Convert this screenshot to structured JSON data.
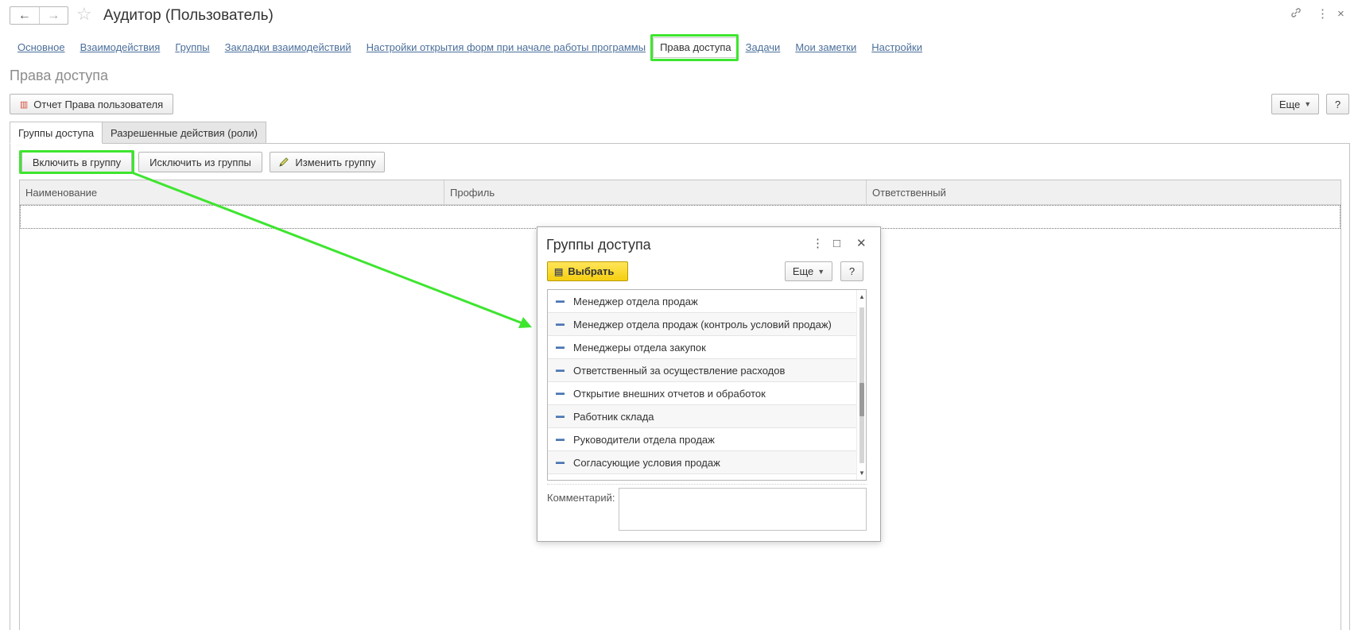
{
  "window": {
    "title": "Аудитор (Пользователь)",
    "back_icon": "←",
    "forward_icon": "→",
    "star_icon": "☆",
    "link_icon": "🔗",
    "more_icon": "⋮",
    "close_icon": "×"
  },
  "sections": [
    {
      "label": "Основное"
    },
    {
      "label": "Взаимодействия"
    },
    {
      "label": "Группы"
    },
    {
      "label": "Закладки взаимодействий"
    },
    {
      "label": "Настройки открытия форм при начале работы программы"
    },
    {
      "label": "Права доступа"
    },
    {
      "label": "Задачи"
    },
    {
      "label": "Мои заметки"
    },
    {
      "label": "Настройки"
    }
  ],
  "form": {
    "title": "Права доступа",
    "report_button": "Отчет Права пользователя",
    "more_button": "Еще",
    "help_button": "?"
  },
  "tabs": [
    {
      "label": "Группы доступа"
    },
    {
      "label": "Разрешенные действия (роли)"
    }
  ],
  "toolbar": {
    "include": "Включить в группу",
    "exclude": "Исключить из группы",
    "change": "Изменить группу"
  },
  "table": {
    "columns": [
      "Наименование",
      "Профиль",
      "Ответственный"
    ]
  },
  "dialog": {
    "title": "Группы доступа",
    "more_icon": "⋮",
    "maximize_icon": "□",
    "close_icon": "✕",
    "select_button": "Выбрать",
    "more_button": "Еще",
    "help_button": "?",
    "items": [
      "Менеджер отдела продаж",
      "Менеджер отдела продаж (контроль условий продаж)",
      "Менеджеры отдела закупок",
      "Ответственный за осуществление расходов",
      "Открытие внешних отчетов и обработок",
      "Работник склада",
      "Руководители отдела продаж",
      "Согласующие условия продаж"
    ],
    "comment_label": "Комментарий:",
    "comment_value": ""
  },
  "highlight_color": "#3ee52f"
}
